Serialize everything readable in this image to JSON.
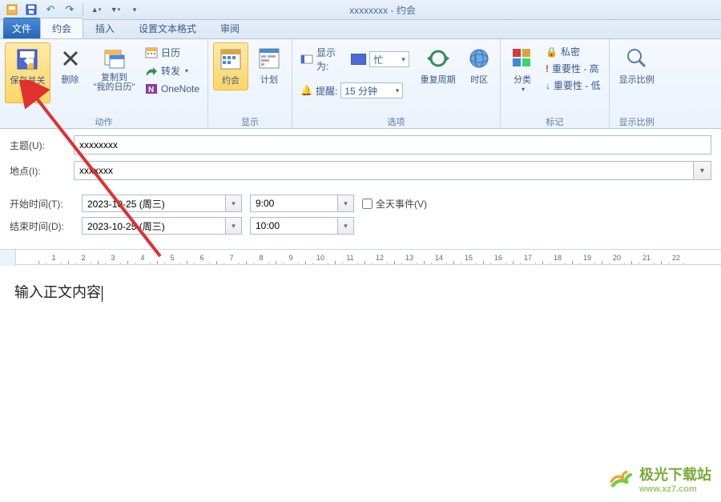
{
  "window": {
    "title": "xxxxxxxx - 约会"
  },
  "qat": {
    "save": "💾",
    "undo": "↶",
    "redo": "↷"
  },
  "tabs": {
    "file": "文件",
    "appointment": "约会",
    "insert": "插入",
    "format": "设置文本格式",
    "review": "审阅"
  },
  "ribbon": {
    "actions": {
      "label": "动作",
      "save_close": "保存并关闭",
      "delete": "删除",
      "copy_cal": "复制到\n\"我的日历\"",
      "calendar": "日历",
      "forward": "转发",
      "onenote": "OneNote"
    },
    "show": {
      "label": "显示",
      "appointment": "约会",
      "scheduling": "计划"
    },
    "options": {
      "label": "选项",
      "show_as": "显示为:",
      "show_as_value": "忙",
      "reminder": "提醒:",
      "reminder_value": "15 分钟",
      "recurrence": "重复周期",
      "timezone": "时区"
    },
    "tags": {
      "label": "标记",
      "categorize": "分类",
      "private": "私密",
      "high": "重要性 - 高",
      "low": "重要性 - 低"
    },
    "zoom": {
      "label": "显示比例",
      "btn": "显示比例"
    }
  },
  "form": {
    "subject_label": "主题(U):",
    "subject_value": "xxxxxxxx",
    "location_label": "地点(I):",
    "location_value": "xxxxxxx",
    "start_label": "开始时间(T):",
    "start_date": "2023-10-25 (周三)",
    "start_time": "9:00",
    "end_label": "结束时间(D):",
    "end_date": "2023-10-25 (周三)",
    "end_time": "10:00",
    "allday": "全天事件(V)"
  },
  "body": {
    "text": "输入正文内容"
  },
  "watermark": {
    "name": "极光下载站",
    "url": "www.xz7.com"
  }
}
